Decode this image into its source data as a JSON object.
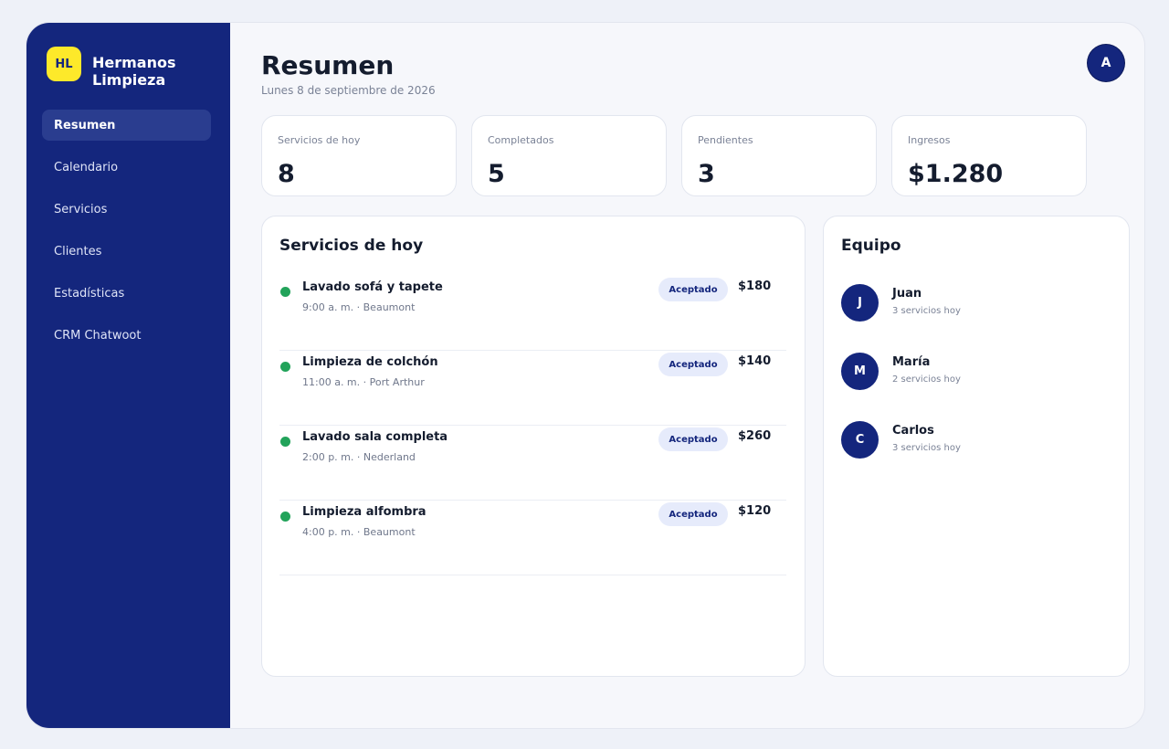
{
  "sidebar": {
    "logo": "HL",
    "brand": "Hermanos Limpieza",
    "items": [
      {
        "label": "Resumen",
        "active": true
      },
      {
        "label": "Calendario"
      },
      {
        "label": "Servicios"
      },
      {
        "label": "Clientes"
      },
      {
        "label": "Estadísticas"
      },
      {
        "label": "CRM Chatwoot"
      }
    ]
  },
  "header": {
    "title": "Resumen",
    "date": "Lunes 8 de septiembre de 2026",
    "avatar": "A"
  },
  "stats": [
    {
      "label": "Servicios de hoy",
      "value": "8"
    },
    {
      "label": "Completados",
      "value": "5"
    },
    {
      "label": "Pendientes",
      "value": "3"
    },
    {
      "label": "Ingresos",
      "value": "$1.280"
    }
  ],
  "services": {
    "title": "Servicios de hoy",
    "items": [
      {
        "name": "Lavado sofá y tapete",
        "meta": "9:00 a. m. · Beaumont",
        "status": "Aceptado",
        "price": "$180"
      },
      {
        "name": "Limpieza de colchón",
        "meta": "11:00 a. m. · Port Arthur",
        "status": "Aceptado",
        "price": "$140"
      },
      {
        "name": "Lavado sala completa",
        "meta": "2:00 p. m. · Nederland",
        "status": "Aceptado",
        "price": "$260"
      },
      {
        "name": "Limpieza alfombra",
        "meta": "4:00 p. m. · Beaumont",
        "status": "Aceptado",
        "price": "$120"
      }
    ]
  },
  "team": {
    "title": "Equipo",
    "members": [
      {
        "initial": "J",
        "name": "Juan",
        "sub": "3 servicios hoy"
      },
      {
        "initial": "M",
        "name": "María",
        "sub": "2 servicios hoy"
      },
      {
        "initial": "C",
        "name": "Carlos",
        "sub": "3 servicios hoy"
      }
    ]
  },
  "colors": {
    "sidebar": "#14267d",
    "logo_bg": "#fde92a",
    "status_dot": "#22a35a",
    "badge_bg": "#e6ebfb"
  }
}
